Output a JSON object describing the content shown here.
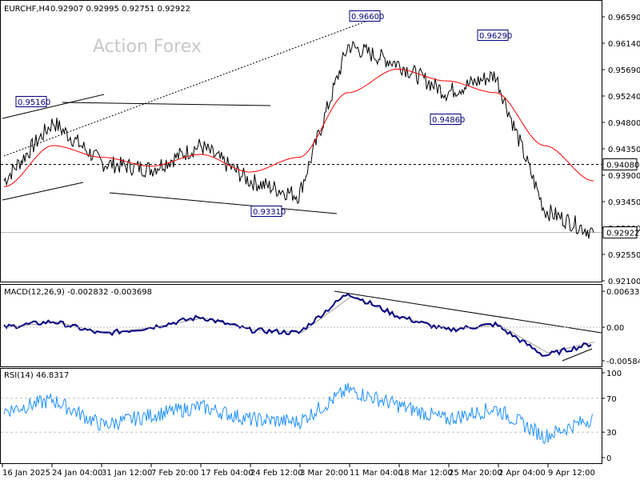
{
  "header": {
    "symbol_tf": "EURCHF,H4",
    "ohlc": "0.92907 0.92995 0.92751 0.92922"
  },
  "watermark": "Action Forex",
  "price_axis_labels": [
    "0.96590",
    "0.96140",
    "0.95690",
    "0.95240",
    "0.94800",
    "0.94350",
    "0.93900",
    "0.93450",
    "0.93000",
    "0.92550",
    "0.92100"
  ],
  "price_tags": {
    "level": "0.94080",
    "current": "0.92922"
  },
  "annotations": [
    {
      "text": "0.96600",
      "price": 0.966
    },
    {
      "text": "0.96290",
      "price": 0.9629
    },
    {
      "text": "0.95160",
      "price": 0.9516
    },
    {
      "text": "0.94860",
      "price": 0.9486
    },
    {
      "text": "0.93310",
      "price": 0.9331
    }
  ],
  "x_axis_labels": [
    "16 Jan 2025",
    "24 Jan 04:00",
    "31 Jan 12:00",
    "7 Feb 20:00",
    "17 Feb 04:00",
    "24 Feb 12:00",
    "3 Mar 20:00",
    "11 Mar 04:00",
    "18 Mar 12:00",
    "25 Mar 20:00",
    "2 Apr 04:00",
    "9 Apr 12:00"
  ],
  "macd": {
    "title": "MACD(12,26,9) -0.002832 -0.003698",
    "axis_labels": [
      "0.006332",
      "0.00",
      "-0.005845"
    ]
  },
  "rsi": {
    "title": "RSI(14) 46.8317",
    "axis_labels": [
      "100",
      "70",
      "30",
      "0"
    ]
  },
  "colors": {
    "price_line": "#000000",
    "moving_average": "#ff0000",
    "macd_line": "#000080",
    "signal_line": "#a0a0a0",
    "rsi_line": "#1e90ff",
    "label_border": "#000080"
  },
  "chart_data": [
    {
      "type": "line",
      "panel": "price",
      "x_labels": [
        "16 Jan",
        "24 Jan",
        "31 Jan",
        "7 Feb",
        "17 Feb",
        "24 Feb",
        "3 Mar",
        "11 Mar",
        "18 Mar",
        "25 Mar",
        "2 Apr",
        "9 Apr"
      ],
      "series": [
        {
          "values": [
            0.938,
            0.948,
            0.941,
            0.94,
            0.944,
            0.938,
            0.9355,
            0.961,
            0.958,
            0.953,
            0.956,
            0.933,
            0.9292
          ]
        },
        {
          "values": [
            0.937,
            0.944,
            0.942,
            0.9405,
            0.9425,
            0.9395,
            0.942,
            0.953,
            0.957,
            0.955,
            0.953,
            0.944,
            0.938
          ]
        }
      ],
      "y_range": [
        0.921,
        0.967
      ],
      "horizontal_levels": [
        0.9408,
        0.92922
      ]
    },
    {
      "type": "line",
      "panel": "macd",
      "series": [
        {
          "values": [
            0.0,
            0.001,
            -0.0012,
            0.0,
            0.0018,
            -0.0005,
            -0.001,
            0.006,
            0.002,
            -0.0005,
            0.0005,
            -0.005,
            -0.0028
          ]
        }
      ],
      "y_range": [
        -0.006,
        0.0065
      ]
    },
    {
      "type": "line",
      "panel": "rsi",
      "series": [
        {
          "values": [
            55,
            68,
            38,
            50,
            60,
            45,
            42,
            80,
            62,
            45,
            58,
            25,
            46.8
          ]
        }
      ],
      "y_range": [
        0,
        100
      ],
      "levels": [
        70,
        30
      ]
    }
  ]
}
